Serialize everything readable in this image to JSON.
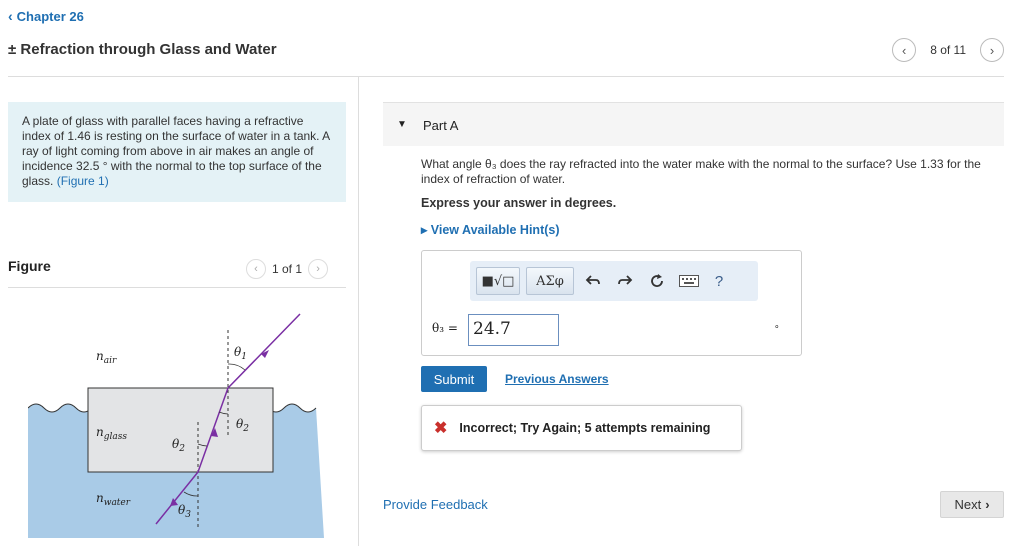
{
  "header": {
    "back_link": "Chapter 26",
    "title": "± Refraction through Glass and Water",
    "pager": {
      "text": "8 of 11"
    }
  },
  "problem": {
    "text": "A plate of glass with parallel faces having a refractive index of 1.46 is resting on the surface of water in a tank. A ray of light coming from above in air makes an angle of incidence 32.5 ° with the normal to the top surface of the glass.",
    "figure_link": "(Figure 1)"
  },
  "figure": {
    "label": "Figure",
    "pager": "1 of 1",
    "labels": {
      "n_air": "n",
      "n_air_sub": "air",
      "n_glass": "n",
      "n_glass_sub": "glass",
      "n_water": "n",
      "n_water_sub": "water",
      "theta1": "θ",
      "theta1_sub": "1",
      "theta2a": "θ",
      "theta2a_sub": "2",
      "theta2b": "θ",
      "theta2b_sub": "2",
      "theta3": "θ",
      "theta3_sub": "3"
    },
    "colors": {
      "water": "#a9cbe7",
      "glass": "#e3e4e6",
      "ray": "#7a2fa3"
    }
  },
  "part_a": {
    "label": "Part A",
    "question": "What angle θ₃ does the ray refracted into the water make with the normal to the surface? Use 1.33 for the index of refraction of water.",
    "express": "Express your answer in degrees.",
    "hints": "View Available Hint(s)",
    "toolbar": {
      "template": "■√□",
      "greek": "ΑΣφ",
      "undo_icon": "undo-icon",
      "redo_icon": "redo-icon",
      "reset_icon": "reset-icon",
      "keyboard_icon": "keyboard-icon",
      "help": "?"
    },
    "answer_label": "θ₃ =",
    "answer_value": "24.7",
    "unit": "∘",
    "submit": "Submit",
    "previous_answers": "Previous Answers",
    "feedback": "Incorrect; Try Again; 5 attempts remaining"
  },
  "footer": {
    "provide_feedback": "Provide Feedback",
    "next": "Next"
  }
}
